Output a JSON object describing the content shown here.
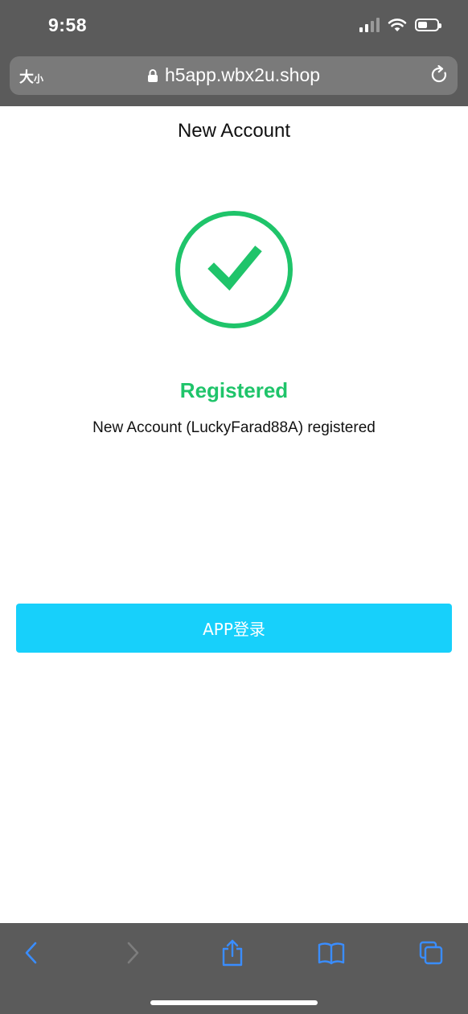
{
  "status_bar": {
    "time": "9:58"
  },
  "browser": {
    "text_size_big": "大",
    "text_size_small": "小",
    "url": "h5app.wbx2u.shop"
  },
  "page": {
    "title": "New Account",
    "result_title": "Registered",
    "result_message": "New Account (LuckyFarad88A) registered",
    "login_button_label": "APP登录"
  },
  "colors": {
    "success_green": "#1fc46a",
    "button_cyan": "#17d0fb",
    "toolbar_blue": "#3a8dff",
    "chrome_gray": "#5b5b5b"
  },
  "icons": {
    "status": [
      "signal-icon",
      "wifi-icon",
      "battery-icon"
    ],
    "address_bar": [
      "lock-icon",
      "reload-icon"
    ],
    "result": "check-circle-icon",
    "toolbar": [
      "back-icon",
      "forward-icon",
      "share-icon",
      "bookmarks-icon",
      "tabs-icon"
    ]
  }
}
